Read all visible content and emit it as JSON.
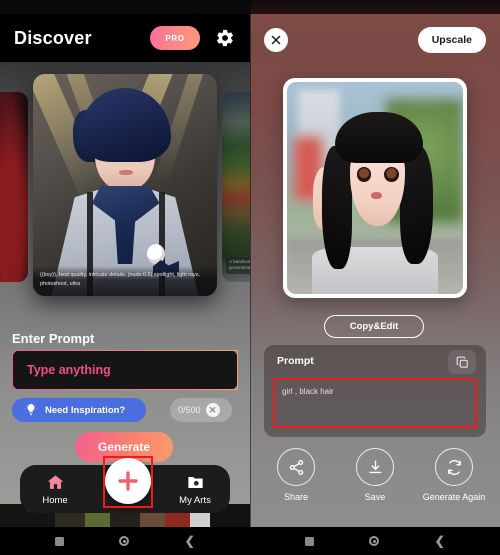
{
  "left_screen": {
    "header": {
      "title": "Discover",
      "pro_badge": "PRO",
      "settings_icon": "gear-icon"
    },
    "carousel": {
      "main_card_caption": "((boy)), best quality, intricate details, (nude:0.5),spotlight, light rays, photoshoot, ultra",
      "side_card_right_caption": "A handsome\ngroomsman"
    },
    "prompt_section": {
      "label": "Enter Prompt",
      "placeholder": "Type anything",
      "value": ""
    },
    "inspiration_button": {
      "label": "Need Inspiration?",
      "icon": "lightbulb-icon",
      "color": "#4a6ee0"
    },
    "counter": {
      "text": "0/500",
      "clear_icon": "close-x-icon"
    },
    "generate_button": {
      "label": "Generate",
      "color": "#f9806f"
    },
    "tabbar": {
      "items": [
        {
          "label": "Home",
          "icon": "home-icon"
        },
        {
          "label": "My Arts",
          "icon": "folder-photo-icon"
        }
      ],
      "fab": {
        "icon": "plus-icon",
        "highlighted": true
      }
    },
    "system_nav": {
      "recents": "square-icon",
      "home": "circle-dot-icon",
      "back": "chevron-left-icon"
    }
  },
  "right_screen": {
    "header": {
      "close_label": "✕",
      "close_icon": "close-x-icon",
      "upscale_label": "Upscale"
    },
    "result": {
      "image_alt": "generated-girl-portrait"
    },
    "copy_edit_button": {
      "label": "Copy&Edit"
    },
    "prompt_card": {
      "title": "Prompt",
      "copy_icon": "copy-icon",
      "text": "girl , black hair",
      "highlighted": true
    },
    "actions": [
      {
        "label": "Share",
        "icon": "share-icon"
      },
      {
        "label": "Save",
        "icon": "download-icon"
      },
      {
        "label": "Generate\nAgain",
        "icon": "refresh-icon"
      }
    ],
    "system_nav": {
      "recents": "square-icon",
      "home": "circle-dot-icon",
      "back": "chevron-left-icon"
    }
  },
  "annotations": {
    "highlight_color": "#ef1b1b",
    "boxes": [
      "fab-plus-button",
      "prompt-card-text"
    ]
  }
}
